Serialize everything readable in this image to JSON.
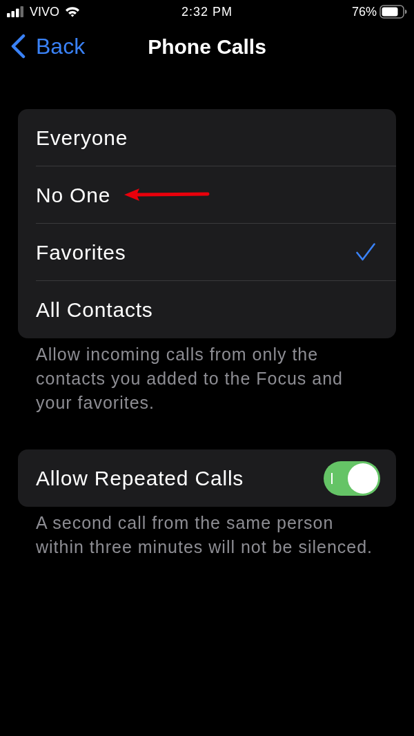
{
  "status_bar": {
    "carrier": "VIVO",
    "time": "2:32 PM",
    "battery": "76%"
  },
  "nav": {
    "back": "Back",
    "title": "Phone Calls"
  },
  "options": [
    {
      "label": "Everyone",
      "selected": false
    },
    {
      "label": "No One",
      "selected": false
    },
    {
      "label": "Favorites",
      "selected": true
    },
    {
      "label": "All Contacts",
      "selected": false
    }
  ],
  "options_footer": "Allow incoming calls from only the contacts you added to the Focus and your favorites.",
  "toggles": [
    {
      "label": "Allow Repeated Calls",
      "on": true
    }
  ],
  "toggles_footer": "A second call from the same person within three minutes will not be silenced."
}
